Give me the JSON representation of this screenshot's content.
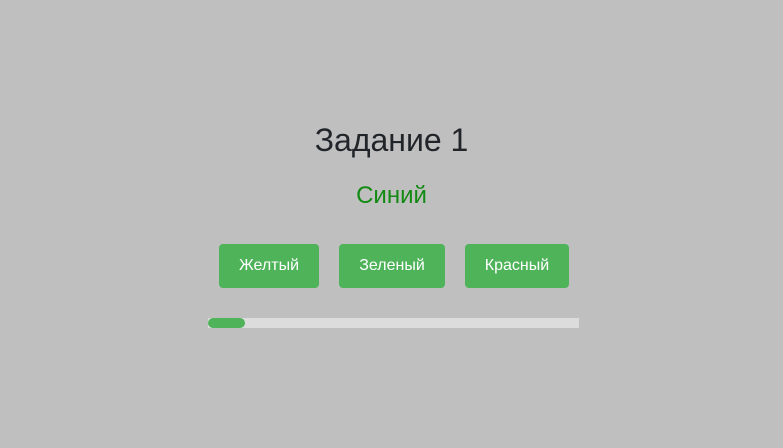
{
  "task": {
    "title": "Задание 1",
    "word": "Синий",
    "word_color": "#138a13"
  },
  "answers": [
    {
      "label": "Желтый"
    },
    {
      "label": "Зеленый"
    },
    {
      "label": "Красный"
    }
  ],
  "button_color": "#4fb35a",
  "progress": {
    "fraction": 0.1,
    "fill_color": "#4fb35a"
  }
}
